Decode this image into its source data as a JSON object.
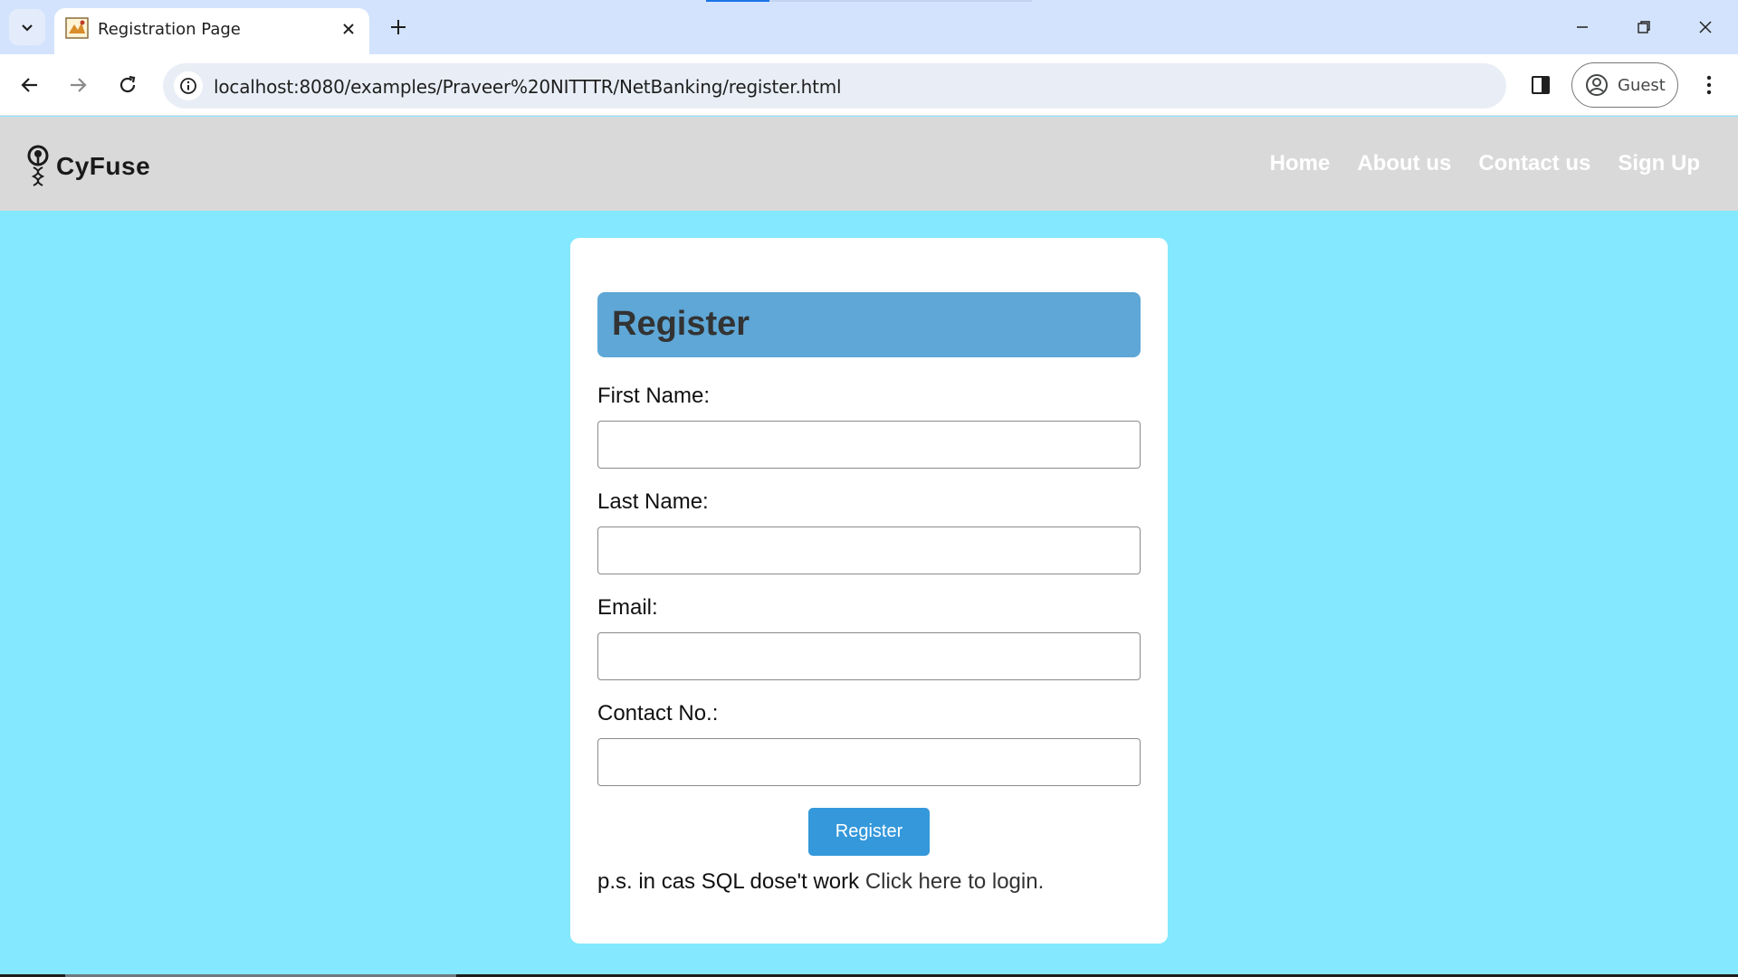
{
  "browser": {
    "tab_title": "Registration Page",
    "url": "localhost:8080/examples/Praveer%20NITTTR/NetBanking/register.html",
    "profile_label": "Guest",
    "icons": {
      "tab_search": "chevron-down-icon",
      "favicon": "page-favicon-icon",
      "tab_close": "close-icon",
      "new_tab": "plus-icon",
      "back": "arrow-left-icon",
      "forward": "arrow-right-icon",
      "reload": "reload-icon",
      "site_info": "info-icon",
      "side_panel": "side-panel-icon",
      "profile": "person-circle-icon",
      "menu": "more-vertical-icon",
      "minimize": "minimize-icon",
      "restore": "restore-icon",
      "close": "close-icon"
    }
  },
  "navbar": {
    "brand": "CyFuse",
    "links": [
      "Home",
      "About us",
      "Contact us",
      "Sign Up"
    ]
  },
  "form": {
    "heading": "Register",
    "fields": [
      {
        "label": "First Name:",
        "value": ""
      },
      {
        "label": "Last Name:",
        "value": ""
      },
      {
        "label": "Email:",
        "value": ""
      },
      {
        "label": "Contact No.:",
        "value": ""
      }
    ],
    "submit_label": "Register",
    "note_text": "p.s. in cas SQL dose't work ",
    "note_link": "Click here to login."
  },
  "colors": {
    "page_bg": "#84e8ff",
    "navbar_bg": "#d9d9d9",
    "card_header_bg": "#5ea7d6",
    "button_bg": "#3498db"
  }
}
